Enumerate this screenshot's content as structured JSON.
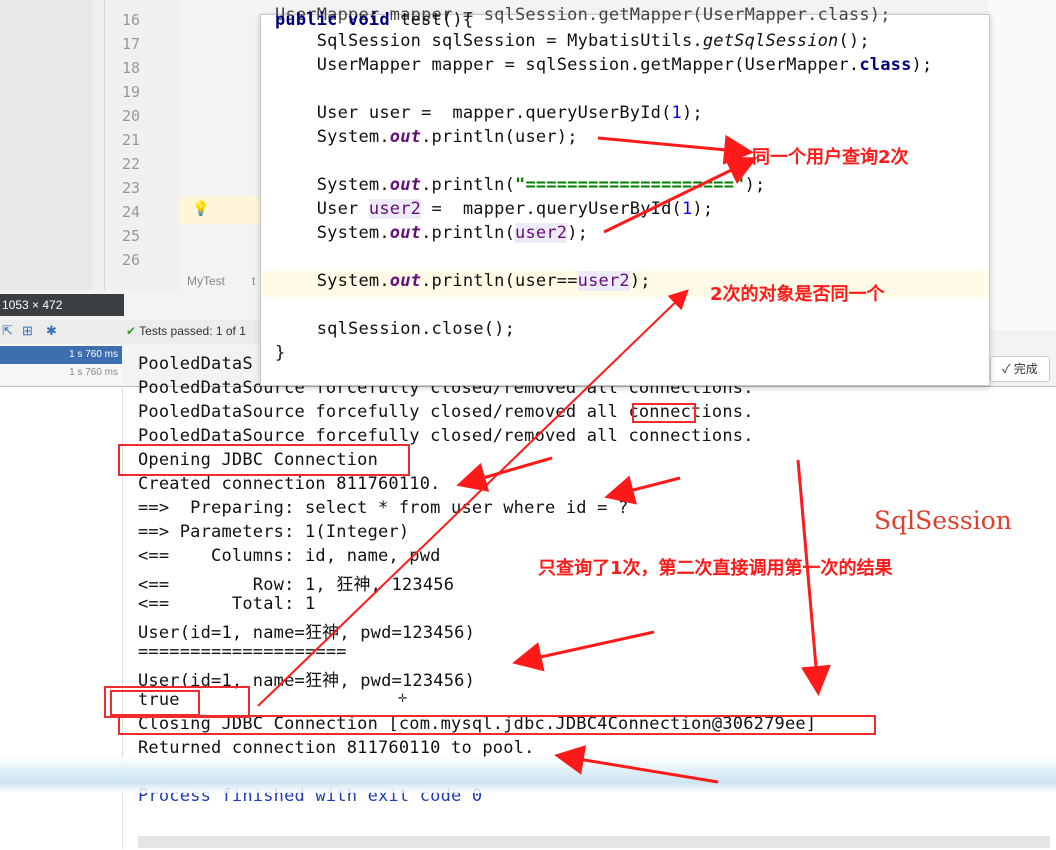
{
  "ide": {
    "line_numbers": [
      "16",
      "17",
      "18",
      "19",
      "20",
      "21",
      "22",
      "23",
      "24",
      "25",
      "26"
    ],
    "run_tab": "MyTest",
    "run_tab_suffix": "t",
    "dimension_label": "1053 × 472",
    "tests_passed": "Tests passed: 1 of 1",
    "run_times": [
      "1 s 760 ms",
      "1 s 760 ms"
    ],
    "done_button": "✓ 完成"
  },
  "code": {
    "cut_top_line": "UserMapper mapper = sqlSession.getMapper(UserMapper.class);",
    "method_signature": "public void test(){",
    "line17": "    SqlSession sqlSession = MybatisUtils.getSqlSession();",
    "line18": "    UserMapper mapper = sqlSession.getMapper(UserMapper.class);",
    "line20": "    User user =  mapper.queryUserById(1);",
    "line21": "    System.out.println(user);",
    "line23": "    System.out.println(\"====================\");",
    "line24": "    User user2 =  mapper.queryUserById(1);",
    "line25": "    System.out.println(user2);",
    "line27": "    System.out.println(user==user2);",
    "line29": "    sqlSession.close();",
    "closing_brace": "}"
  },
  "console": {
    "lines": [
      "PooledDataSource forcefully closed/removed all connections.",
      "PooledDataSource forcefully closed/removed all connections.",
      "PooledDataSource forcefully closed/removed all connections.",
      "Opening JDBC Connection",
      "Created connection 811760110.",
      "==>  Preparing: select * from user where id = ?",
      "==> Parameters: 1(Integer)",
      "<==    Columns: id, name, pwd",
      "<==        Row: 1, 狂神, 123456",
      "<==      Total: 1",
      "User(id=1, name=狂神, pwd=123456)",
      "====================",
      "User(id=1, name=狂神, pwd=123456)",
      "true",
      "Closing JDBC Connection [com.mysql.jdbc.JDBC4Connection@306279ee]",
      "Returned connection 811760110 to pool.",
      "",
      "Process finished with exit code 0"
    ],
    "partial_top_line": "PooledDataS"
  },
  "annotations": {
    "same_user_twice": "同一个用户查询2次",
    "same_object": "2次的对象是否同一个",
    "queried_once": "只查询了1次，第二次直接调用第一次的结果",
    "sqlsession": "SqlSession"
  },
  "colors": {
    "annotation_red": "#ff1a1a",
    "keyword": "#000080",
    "string": "#008000",
    "number": "#0000ff",
    "exit_text": "#1d3bb8"
  }
}
